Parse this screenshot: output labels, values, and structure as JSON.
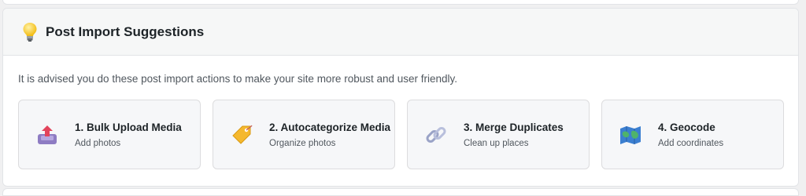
{
  "panel": {
    "title": "Post Import Suggestions",
    "icon": "lightbulb-icon",
    "description": "It is advised you do these post import actions to make your site more robust and user friendly."
  },
  "cards": [
    {
      "title": "1. Bulk Upload Media",
      "subtitle": "Add photos",
      "icon": "upload-tray-icon"
    },
    {
      "title": "2. Autocategorize Media",
      "subtitle": "Organize photos",
      "icon": "tag-icon"
    },
    {
      "title": "3. Merge Duplicates",
      "subtitle": "Clean up places",
      "icon": "link-icon"
    },
    {
      "title": "4. Geocode",
      "subtitle": "Add coordinates",
      "icon": "map-icon"
    }
  ],
  "colors": {
    "header_bg": "#f6f7f7",
    "card_bg": "#f6f7f9",
    "card_border": "#dcdcde"
  }
}
